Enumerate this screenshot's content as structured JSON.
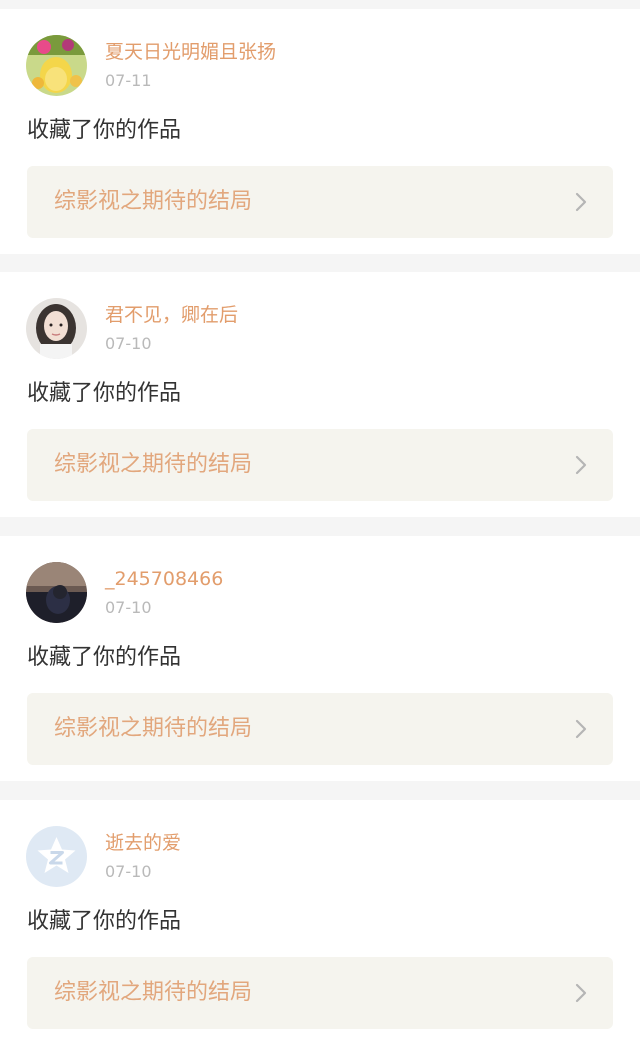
{
  "colors": {
    "username": "#e29d6c",
    "date": "#b9b9b9",
    "action": "#333333",
    "work_title": "#e2a77d",
    "work_box_bg": "#f5f4ee",
    "page_bg": "#f5f5f5"
  },
  "notifications": [
    {
      "username": "夏天日光明媚且张扬",
      "date": "07-11",
      "action": "收藏了你的作品",
      "work_title": "综影视之期待的结局",
      "avatar": "avatar-flowers-photo",
      "chevron_icon": "chevron-right-icon"
    },
    {
      "username": "君不见，卿在后",
      "date": "07-10",
      "action": "收藏了你的作品",
      "work_title": "综影视之期待的结局",
      "avatar": "avatar-girl-photo",
      "chevron_icon": "chevron-right-icon"
    },
    {
      "username": "_245708466",
      "date": "07-10",
      "action": "收藏了你的作品",
      "work_title": "综影视之期待的结局",
      "avatar": "avatar-dark-photo",
      "chevron_icon": "chevron-right-icon"
    },
    {
      "username": "逝去的爱",
      "date": "07-10",
      "action": "收藏了你的作品",
      "work_title": "综影视之期待的结局",
      "avatar": "avatar-default-star",
      "chevron_icon": "chevron-right-icon"
    }
  ]
}
